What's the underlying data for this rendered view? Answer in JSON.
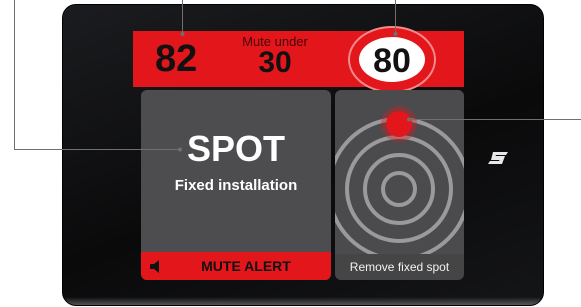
{
  "topbar": {
    "current_speed": "82",
    "mute_under_label": "Mute under",
    "mute_under_value": "30",
    "speed_limit": "80"
  },
  "spot_panel": {
    "title": "SPOT",
    "subtitle": "Fixed installation",
    "mute_alert_label": "MUTE ALERT",
    "mute_alert_icon": "speaker-icon"
  },
  "radar_panel": {
    "remove_label": "Remove fixed spot",
    "icon": "radar-target-icon"
  },
  "brand": {
    "icon": "brand-logo-icon"
  },
  "colors": {
    "alert_red": "#e3161b",
    "panel_grey": "#4d4d4f",
    "device_black": "#0d0e10",
    "callout_line": "#6f6f6f"
  }
}
